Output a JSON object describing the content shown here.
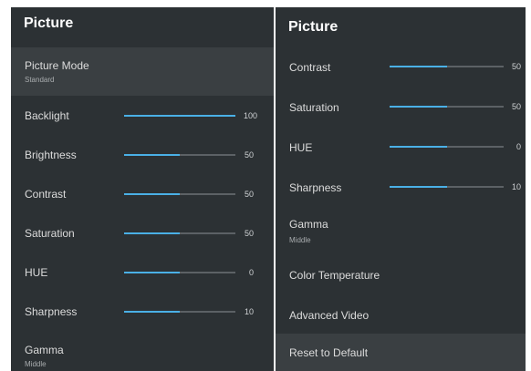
{
  "accent_color": "#4ab0e6",
  "left_panel": {
    "title": "Picture",
    "picture_mode": {
      "label": "Picture Mode",
      "value": "Standard"
    },
    "sliders": [
      {
        "label": "Backlight",
        "value": "100",
        "fraction": 1.0
      },
      {
        "label": "Brightness",
        "value": "50",
        "fraction": 0.5
      },
      {
        "label": "Contrast",
        "value": "50",
        "fraction": 0.5
      },
      {
        "label": "Saturation",
        "value": "50",
        "fraction": 0.5
      },
      {
        "label": "HUE",
        "value": "0",
        "fraction": 0.5
      },
      {
        "label": "Sharpness",
        "value": "10",
        "fraction": 0.5
      }
    ],
    "gamma": {
      "label": "Gamma",
      "value": "Middle"
    }
  },
  "right_panel": {
    "title": "Picture",
    "sliders": [
      {
        "label": "Contrast",
        "value": "50",
        "fraction": 0.5
      },
      {
        "label": "Saturation",
        "value": "50",
        "fraction": 0.5
      },
      {
        "label": "HUE",
        "value": "0",
        "fraction": 0.5
      },
      {
        "label": "Sharpness",
        "value": "10",
        "fraction": 0.5
      }
    ],
    "gamma": {
      "label": "Gamma",
      "value": "Middle"
    },
    "items": [
      {
        "label": "Color Temperature"
      },
      {
        "label": "Advanced Video"
      },
      {
        "label": "Reset to Default"
      }
    ]
  }
}
